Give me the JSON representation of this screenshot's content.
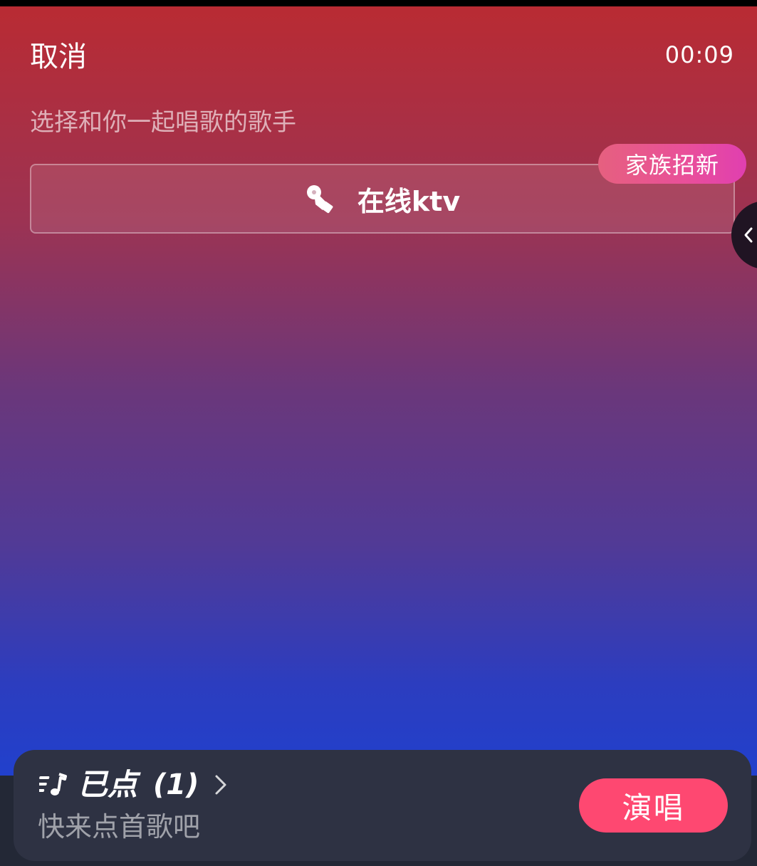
{
  "header": {
    "cancel_label": "取消",
    "timer": "00:09"
  },
  "selection": {
    "subtitle": "选择和你一起唱歌的歌手",
    "ktv_option": {
      "label": "在线ktv",
      "icon": "microphone-icon"
    },
    "family_badge": "家族招新"
  },
  "side_handle": {
    "icon": "chevron-left-icon"
  },
  "bottom_panel": {
    "queue_icon": "playlist-icon",
    "queue_label": "已点",
    "queue_count": "(1)",
    "queue_chevron": "chevron-right-icon",
    "hint": "快来点首歌吧",
    "sing_button": "演唱"
  },
  "colors": {
    "gradient_top": "#b92b33",
    "gradient_bottom": "#2140cc",
    "badge": "#e94f9a",
    "sing_button": "#fe4871",
    "panel": "#2e3243"
  }
}
